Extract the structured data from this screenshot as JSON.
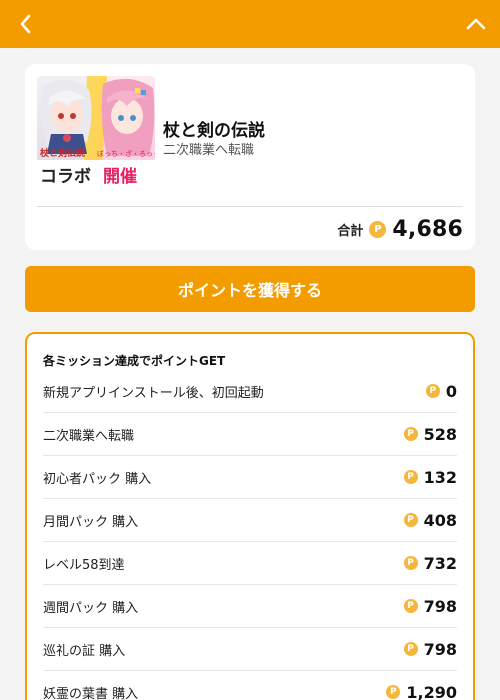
{
  "header": {
    "back_icon": "chevron-left-icon",
    "collapse_icon": "chevron-up-icon",
    "background": "#f39c00"
  },
  "app": {
    "title": "杖と剣の伝説",
    "subtitle": "二次職業へ転職",
    "banner_text": {
      "logo": "杖と剣伝説",
      "tagline": "ぼっち・ざ・ろっく!",
      "collab": "コラボ",
      "event": "開催"
    },
    "total_label": "合計",
    "total_points": "4,686",
    "coin_symbol": "P"
  },
  "cta": {
    "label": "ポイントを獲得する"
  },
  "missions": {
    "heading": "各ミッション達成でポイントGET",
    "items": [
      {
        "name": "新規アプリインストール後、初回起動",
        "points": "0"
      },
      {
        "name": "二次職業へ転職",
        "points": "528"
      },
      {
        "name": "初心者パック 購入",
        "points": "132"
      },
      {
        "name": "月間パック 購入",
        "points": "408"
      },
      {
        "name": "レベル58到達",
        "points": "732"
      },
      {
        "name": "週間パック 購入",
        "points": "798"
      },
      {
        "name": "巡礼の証 購入",
        "points": "798"
      },
      {
        "name": "妖霊の葉書 購入",
        "points": "1,290"
      }
    ]
  },
  "colors": {
    "accent": "#f39c00",
    "coin": "#f5b73b"
  }
}
